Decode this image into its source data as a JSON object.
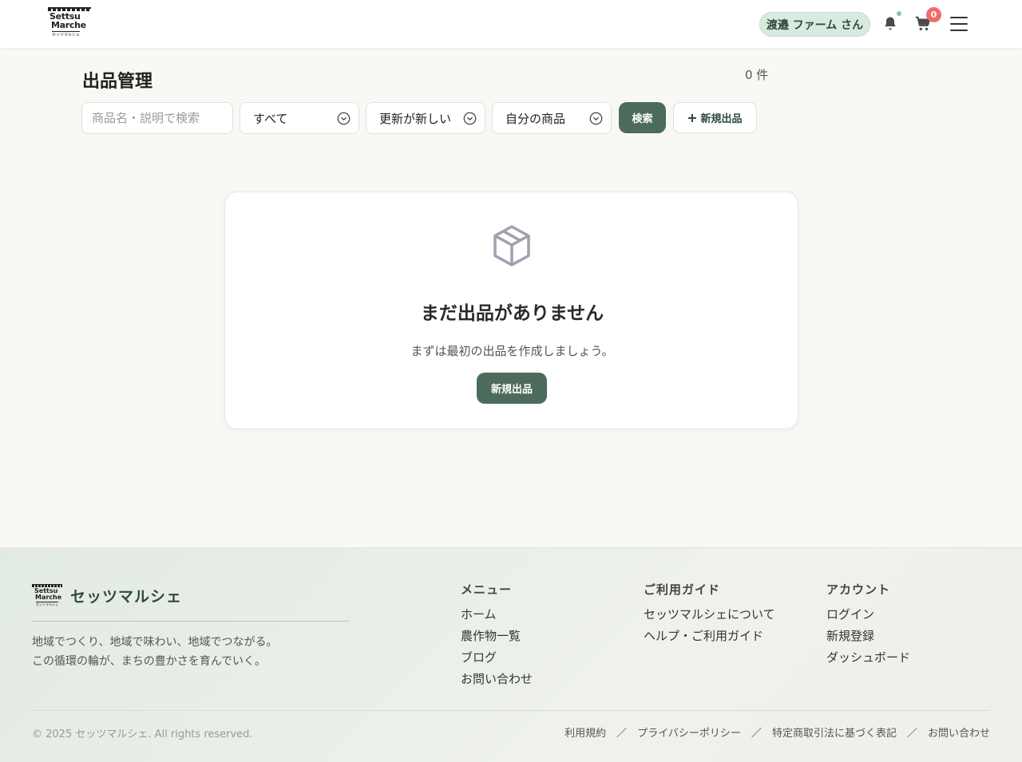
{
  "header": {
    "logo": {
      "line1": "Settsu",
      "line2": "Marche",
      "line3": "セッツマルシェ"
    },
    "user_name": "渡邉 ファーム さん",
    "cart_count": "0"
  },
  "main": {
    "title": "出品管理",
    "count": "0 件",
    "search_placeholder": "商品名・説明で検索",
    "filter_status": "すべて",
    "filter_sort": "更新が新しい",
    "filter_owner": "自分の商品",
    "search_label": "検索",
    "new_label": "新規出品"
  },
  "empty": {
    "title": "まだ出品がありません",
    "subtitle": "まずは最初の出品を作成しましょう。",
    "button": "新規出品"
  },
  "footer": {
    "brand": "セッツマルシェ",
    "tagline1": "地域でつくり、地域で味わい、地域でつながる。",
    "tagline2": "この循環の輪が、まちの豊かさを育んでいく。",
    "menu": {
      "title": "メニュー",
      "items": [
        "ホーム",
        "農作物一覧",
        "ブログ",
        "お問い合わせ"
      ]
    },
    "guide": {
      "title": "ご利用ガイド",
      "items": [
        "セッツマルシェについて",
        "ヘルプ・ご利用ガイド"
      ]
    },
    "account": {
      "title": "アカウント",
      "items": [
        "ログイン",
        "新規登録",
        "ダッシュボード"
      ]
    },
    "copyright": "© 2025 セッツマルシェ. All rights reserved.",
    "legal": [
      "利用規約",
      "プライバシーポリシー",
      "特定商取引法に基づく表記",
      "お問い合わせ"
    ],
    "separator": "／"
  },
  "colors": {
    "accent": "#4c6b5c",
    "badge": "#f26a6a",
    "pill_bg": "#d9eadf"
  }
}
